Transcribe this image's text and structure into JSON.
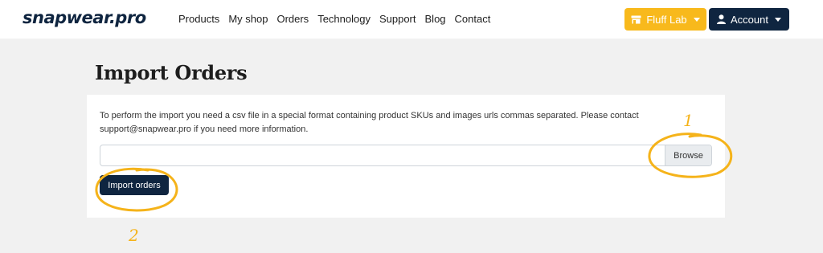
{
  "brand": {
    "logo": "snapwear.pro"
  },
  "nav": {
    "links": [
      "Products",
      "My shop",
      "Orders",
      "Technology",
      "Support",
      "Blog",
      "Contact"
    ]
  },
  "header_buttons": {
    "shop_label": "Fluff Lab",
    "account_label": "Account"
  },
  "main": {
    "title": "Import Orders",
    "info_text": "To perform the import you need a csv file in a special format containing product SKUs and images urls commas separated. Please contact support@snapwear.pro if you need more information.",
    "browse_label": "Browse",
    "import_label": "Import orders"
  },
  "annotations": {
    "marker_1": "1",
    "marker_2": "2",
    "color": "#f5b31a"
  },
  "colors": {
    "navy": "#0f2540",
    "amber": "#f8b91c",
    "background": "#f1f1f1"
  },
  "icons": {
    "shop": "store-icon",
    "account": "user-icon",
    "dropdown": "caret-down-icon"
  }
}
